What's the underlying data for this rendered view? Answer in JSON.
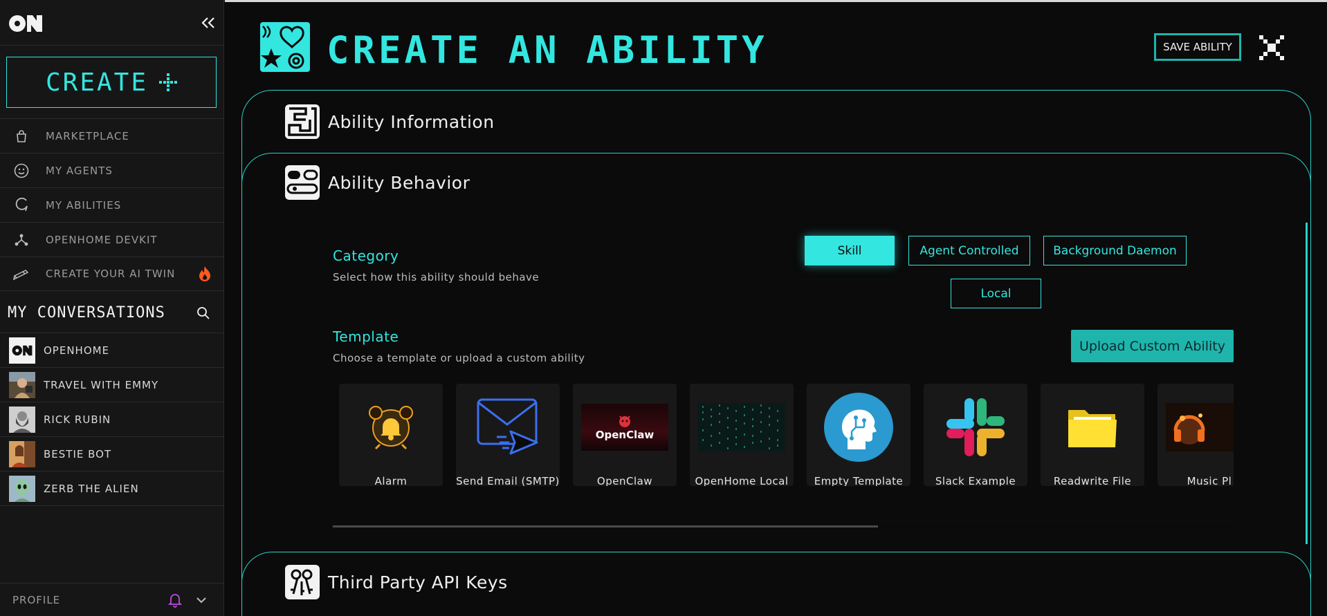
{
  "sidebar": {
    "create_label": "CREATE",
    "nav": [
      {
        "label": "MARKETPLACE",
        "icon": "bag-icon"
      },
      {
        "label": "MY AGENTS",
        "icon": "smiley-icon"
      },
      {
        "label": "MY ABILITIES",
        "icon": "loop-icon"
      },
      {
        "label": "OPENHOME DEVKIT",
        "icon": "nodes-icon"
      },
      {
        "label": "CREATE YOUR AI TWIN",
        "icon": "pen-icon"
      }
    ],
    "conversations_title": "MY CONVERSATIONS",
    "conversations": [
      {
        "name": "OPENHOME"
      },
      {
        "name": "TRAVEL WITH EMMY"
      },
      {
        "name": "RICK RUBIN"
      },
      {
        "name": "BESTIE BOT"
      },
      {
        "name": "ZERB THE ALIEN"
      }
    ],
    "profile_label": "PROFILE"
  },
  "main": {
    "title": "CREATE AN ABILITY",
    "save_label": "SAVE ABILITY",
    "sections": {
      "info": "Ability Information",
      "behavior": "Ability Behavior",
      "api": "Third Party API Keys"
    },
    "category": {
      "label": "Category",
      "sub": "Select how this ability should behave",
      "options": [
        "Skill",
        "Agent Controlled",
        "Background Daemon",
        "Local"
      ],
      "selected": "Skill"
    },
    "template": {
      "label": "Template",
      "sub": "Choose a template or upload a custom ability",
      "upload_label": "Upload Custom Ability",
      "cards": [
        {
          "label": "Alarm"
        },
        {
          "label": "Send Email (SMTP)"
        },
        {
          "label": "OpenClaw",
          "banner": "OpenClaw"
        },
        {
          "label": "OpenHome Local Link"
        },
        {
          "label": "Empty Template"
        },
        {
          "label": "Slack Example Template"
        },
        {
          "label": "Readwrite File"
        },
        {
          "label": "Music Pl"
        }
      ],
      "scroll_fraction": 0.605
    }
  },
  "colors": {
    "accent": "#33e6e0",
    "accent_dark": "#1fb5ad",
    "bg": "#0b0b0b",
    "sidebar": "#161616",
    "bell": "#c04ce0",
    "fire": "#ff5a1f"
  }
}
